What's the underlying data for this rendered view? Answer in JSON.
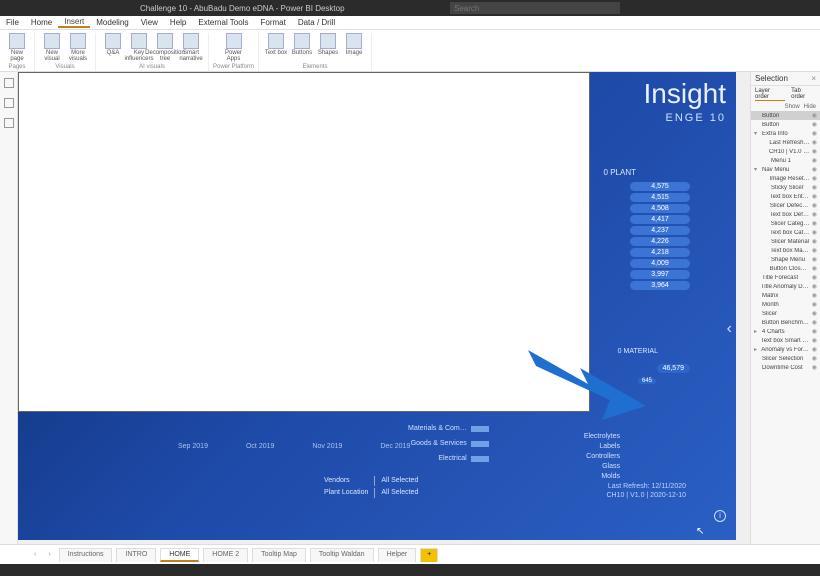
{
  "titlebar": {
    "title": "Challenge 10 - AbuBadu Demo eDNA - Power BI Desktop",
    "search_placeholder": "Search"
  },
  "menubar": {
    "items": [
      "File",
      "Home",
      "Insert",
      "Modeling",
      "View",
      "Help",
      "External Tools",
      "Format",
      "Data / Drill"
    ],
    "active": "Insert"
  },
  "ribbon": {
    "groups": [
      {
        "label": "Pages",
        "buttons": [
          {
            "label": "New page"
          }
        ]
      },
      {
        "label": "Visuals",
        "buttons": [
          {
            "label": "New visual"
          },
          {
            "label": "More visuals"
          }
        ]
      },
      {
        "label": "AI visuals",
        "buttons": [
          {
            "label": "Q&A"
          },
          {
            "label": "Key influencers"
          },
          {
            "label": "Decomposition tree"
          },
          {
            "label": "Smart narrative"
          }
        ]
      },
      {
        "label": "Power Platform",
        "buttons": [
          {
            "label": "Power Apps"
          }
        ]
      },
      {
        "label": "Elements",
        "buttons": [
          {
            "label": "Text box"
          },
          {
            "label": "Buttons"
          },
          {
            "label": "Shapes"
          },
          {
            "label": "Image"
          }
        ]
      }
    ]
  },
  "dashboard": {
    "title": "Insight",
    "subtitle": "ENGE 10",
    "plant_header": "0 PLANT",
    "plant_values": [
      "4,575",
      "4,515",
      "4,508",
      "4,417",
      "4,237",
      "4,226",
      "4,218",
      "4,009",
      "3,997",
      "3,964"
    ],
    "material_header": "0 MATERIAL",
    "material_value": "46,579",
    "material_value2": "645",
    "bar_legend": [
      "Materials & Com…",
      "Goods & Services",
      "Electrical"
    ],
    "right_legend": [
      "Electrolytes",
      "Labels",
      "Controllers",
      "Glass",
      "Molds"
    ],
    "timeline": [
      "Sep 2019",
      "Oct 2019",
      "Nov 2019",
      "Dec 2019"
    ],
    "filters": {
      "row1": [
        "Vendors",
        "All Selected"
      ],
      "row2": [
        "Plant Location",
        "All Selected"
      ]
    },
    "last_refresh": [
      "Last Refresh: 12/11/2020",
      "CH10 | V1.0 | 2020-12-10"
    ]
  },
  "selection": {
    "title": "Selection",
    "tabs": [
      "Layer order",
      "Tab order"
    ],
    "active_tab": "Layer order",
    "showhide": [
      "Show",
      "Hide"
    ],
    "items": [
      {
        "label": "Button",
        "sel": true,
        "chev": ""
      },
      {
        "label": "Button",
        "chev": ""
      },
      {
        "label": "Extra Info",
        "chev": "▾"
      },
      {
        "label": "Last Refresh: 12/1…",
        "indent": true
      },
      {
        "label": "CH10 | V1.0 | 2020-1…",
        "indent": true
      },
      {
        "label": "Menu 1",
        "indent": true
      },
      {
        "label": "Nav Menu",
        "chev": "▾"
      },
      {
        "label": "Image Reset Filters",
        "indent": true
      },
      {
        "label": "Sticky Slicer",
        "indent": true
      },
      {
        "label": "Text box Enter Cost",
        "indent": true
      },
      {
        "label": "Slicer Defect Type",
        "indent": true
      },
      {
        "label": "Text box Defect T…",
        "indent": true
      },
      {
        "label": "Slicer Category",
        "indent": true
      },
      {
        "label": "Text box Category",
        "indent": true
      },
      {
        "label": "Slicer Material",
        "indent": true
      },
      {
        "label": "Text box Material",
        "indent": true
      },
      {
        "label": "Shape Menu",
        "indent": true
      },
      {
        "label": "Button Close Nav…",
        "indent": true
      },
      {
        "label": "Title Forecast"
      },
      {
        "label": "Title Anomaly Detect…"
      },
      {
        "label": "Matrix"
      },
      {
        "label": "Month"
      },
      {
        "label": "Slicer"
      },
      {
        "label": "Button Benchmark"
      },
      {
        "label": "4 Charts",
        "chev": "▸"
      },
      {
        "label": "Text box Smart Narra…"
      },
      {
        "label": "Anomaly vs Forecast",
        "chev": "▸"
      },
      {
        "label": "Slicer Selection"
      },
      {
        "label": "Downtime Cost"
      }
    ]
  },
  "pagetabs": {
    "tabs": [
      "Instructions",
      "INTRO",
      "HOME",
      "HOME 2",
      "Tooltip Map",
      "Tooltip Waldan",
      "Helper"
    ],
    "active": "HOME",
    "add": "+"
  }
}
